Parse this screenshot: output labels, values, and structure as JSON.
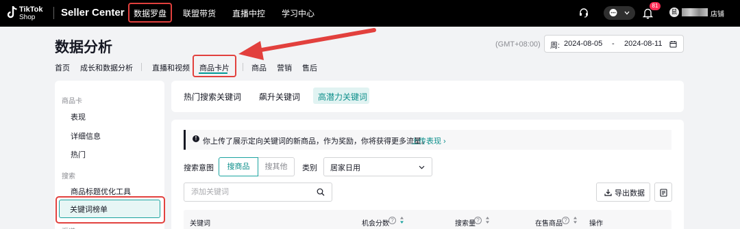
{
  "topbar": {
    "logo_line1": "TikTok",
    "logo_line2": "Shop",
    "brand": "Seller Center",
    "nav": [
      "数据罗盘",
      "联盟带货",
      "直播中控",
      "学习中心"
    ],
    "notification_count": "81",
    "avatar_initial": "鼠",
    "shop_suffix": "店铺",
    "icons": [
      "headset-icon",
      "chat-icon",
      "bell-icon",
      "chevron-down-icon"
    ]
  },
  "header": {
    "title": "数据分析",
    "timezone": "(GMT+08:00)",
    "date_prefix": "周:",
    "date_start": "2024-08-05",
    "date_sep": "-",
    "date_end": "2024-08-11",
    "subtabs": [
      "首页",
      "成长和数据分析",
      "直播和视频",
      "商品卡片",
      "商品",
      "营销",
      "售后"
    ]
  },
  "sidebar": {
    "groups": [
      {
        "label": "商品卡",
        "items": [
          "表现",
          "详细信息",
          "热门"
        ]
      },
      {
        "label": "搜索",
        "items": [
          "商品标题优化工具",
          "关键词榜单"
        ]
      },
      {
        "label": "渠道",
        "items": []
      }
    ],
    "active": "关键词榜单"
  },
  "keyword_tabs": [
    "热门搜索关键词",
    "飙升关键词",
    "高潜力关键词"
  ],
  "notice": {
    "text": "你上传了展示定向关键词的新商品，作为奖励，你将获得更多流量。",
    "link": "上传表现 ›"
  },
  "filters": {
    "intent_label": "搜索意图",
    "intent_options": [
      "搜商品",
      "搜其他"
    ],
    "category_label": "类别",
    "category_value": "居家日用",
    "search_placeholder": "添加关键词",
    "export_label": "导出数据"
  },
  "table": {
    "columns": [
      "关键词",
      "机会分数",
      "搜索量",
      "在售商品",
      "操作"
    ]
  },
  "colors": {
    "accent": "#009995",
    "highlight": "#e2403d",
    "badge": "#fe2c55"
  }
}
